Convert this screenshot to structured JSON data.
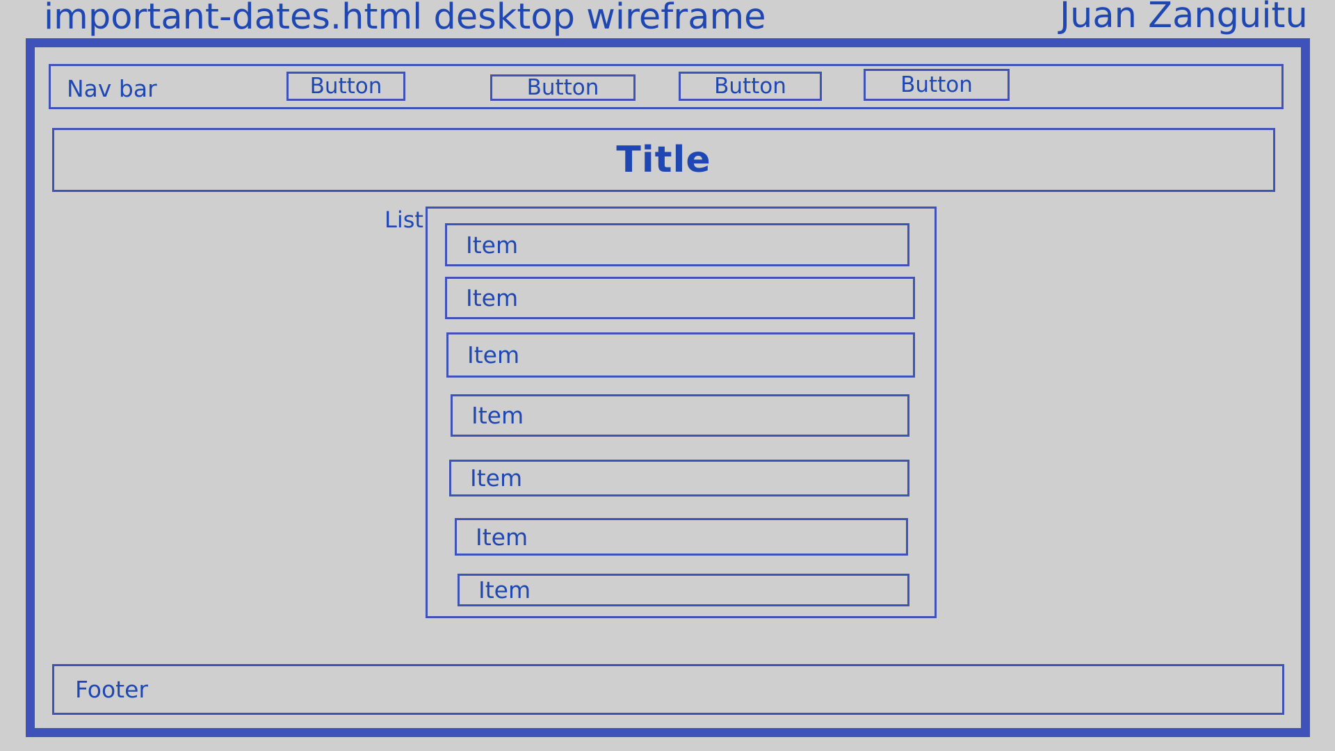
{
  "header": {
    "doc_title": "important-dates.html desktop wireframe",
    "author": "Juan Zanguitu"
  },
  "nav": {
    "label": "Nav bar",
    "buttons": [
      "Button",
      "Button",
      "Button",
      "Button"
    ]
  },
  "title": {
    "text": "Title"
  },
  "list": {
    "label": "List",
    "items": [
      "Item",
      "Item",
      "Item",
      "Item",
      "Item",
      "Item",
      "Item"
    ]
  },
  "footer": {
    "label": "Footer"
  },
  "colors": {
    "background": "#cfcfd0",
    "accent": "#3f52b9",
    "text": "#1f47b4"
  }
}
